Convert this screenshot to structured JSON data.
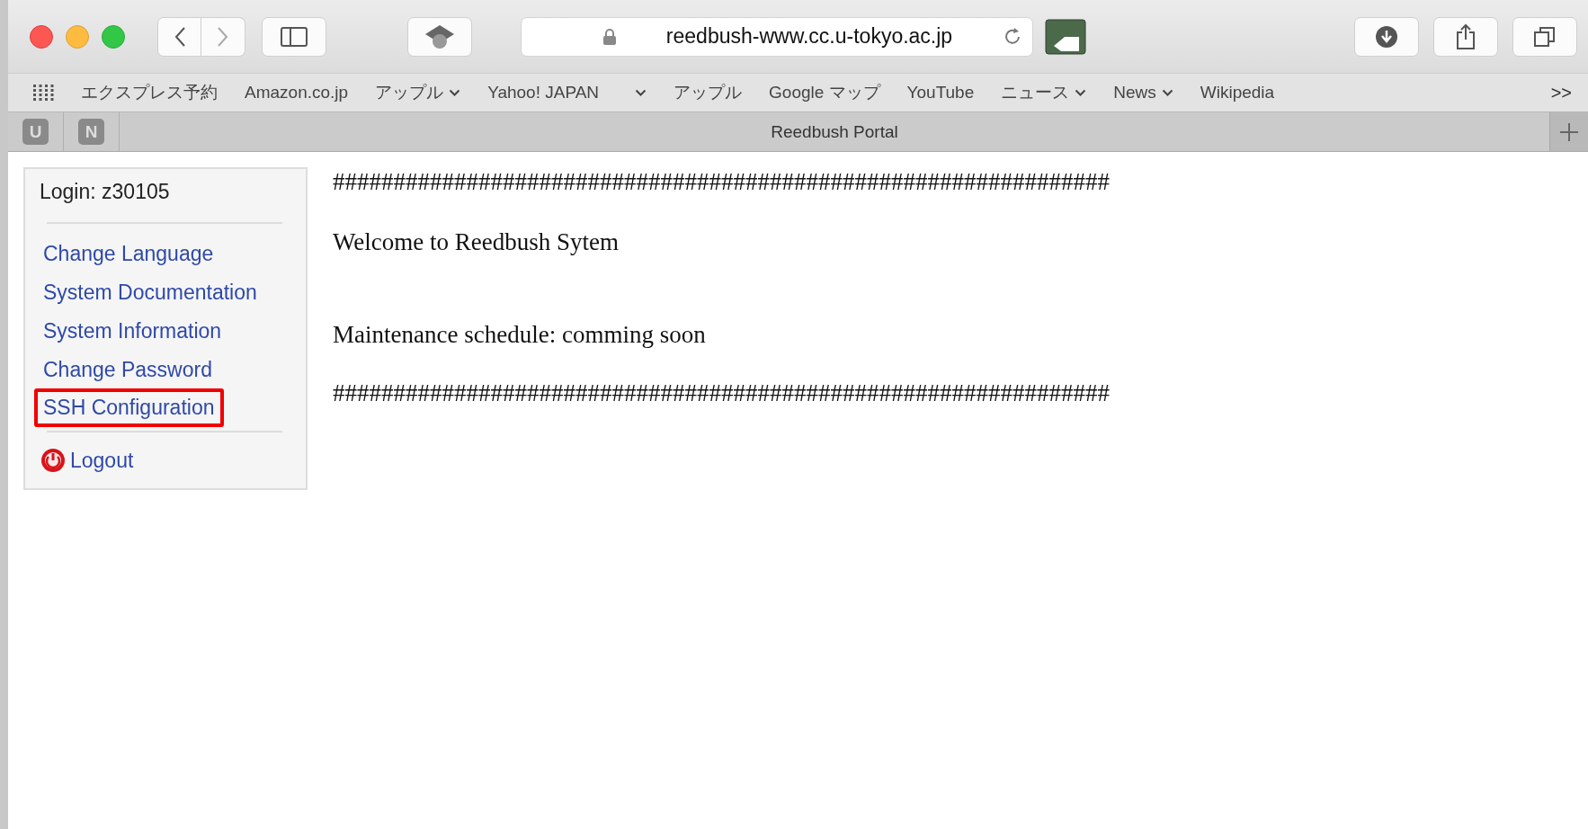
{
  "toolbar": {
    "url": "reedbush-www.cc.u-tokyo.ac.jp"
  },
  "bookmarks": [
    {
      "kind": "link",
      "label": "エクスプレス予約"
    },
    {
      "kind": "link",
      "label": "Amazon.co.jp"
    },
    {
      "kind": "folder",
      "label": "アップル"
    },
    {
      "kind": "link",
      "label": "Yahoo! JAPAN"
    },
    {
      "kind": "chevron"
    },
    {
      "kind": "link",
      "label": "アップル"
    },
    {
      "kind": "link",
      "label": "Google マップ"
    },
    {
      "kind": "link",
      "label": "YouTube"
    },
    {
      "kind": "folder",
      "label": "ニュース"
    },
    {
      "kind": "folder",
      "label": "News"
    },
    {
      "kind": "link",
      "label": "Wikipedia"
    }
  ],
  "bookmarks_overflow": ">>",
  "pinned_tabs": [
    "U",
    "N"
  ],
  "tab_title": "Reedbush Portal",
  "sidebar": {
    "login": "Login: z30105",
    "items": [
      {
        "label": "Change Language",
        "highlighted": false
      },
      {
        "label": "System Documentation",
        "highlighted": false
      },
      {
        "label": "System Information",
        "highlighted": false
      },
      {
        "label": "Change Password",
        "highlighted": false
      },
      {
        "label": "SSH Configuration",
        "highlighted": true
      }
    ],
    "logout": "Logout"
  },
  "content": [
    "################################################################",
    "Welcome to Reedbush Sytem",
    "Maintenance schedule: comming soon",
    "################################################################"
  ]
}
